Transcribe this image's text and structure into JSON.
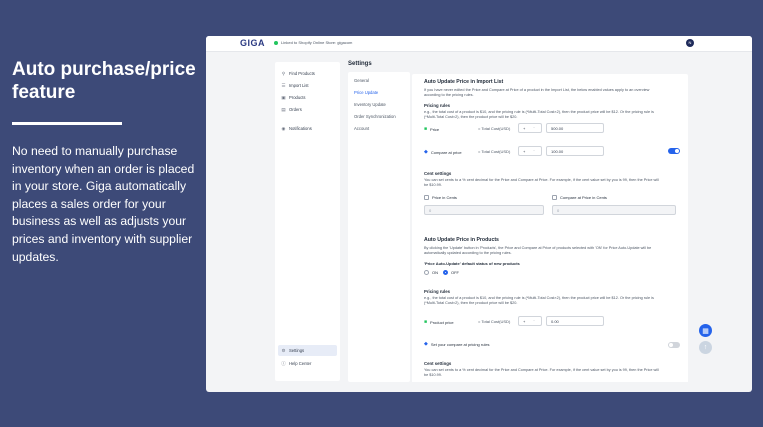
{
  "promo": {
    "title": "Auto purchase/price feature",
    "body": "No need to manually purchase inventory when an order is placed in your store. Giga automatically places a sales order for your business as well as adjusts your prices and inventory with supplier updates."
  },
  "app": {
    "logo": "GIGA",
    "connection_text": "Linked to Shopify Online Store: gigacom",
    "avatar_initial": "N",
    "page_title": "Settings"
  },
  "sidebar": {
    "items": [
      {
        "label": "Find Products",
        "icon": "search-icon"
      },
      {
        "label": "Import List",
        "icon": "list-icon"
      },
      {
        "label": "Products",
        "icon": "box-icon"
      },
      {
        "label": "Orders",
        "icon": "document-icon"
      },
      {
        "label": "Notifications",
        "icon": "bell-icon"
      },
      {
        "label": "Settings",
        "icon": "gear-icon"
      },
      {
        "label": "Help Center",
        "icon": "help-icon"
      }
    ]
  },
  "subnav": {
    "items": [
      "General",
      "Price Update",
      "Inventory Update",
      "Order Synchronization",
      "Account"
    ]
  },
  "import_card": {
    "title": "Auto Update Price in Import List",
    "desc_1": "If you have never edited the Price and Compare at Price of a product in the Import List, the below enabled values apply to an overview",
    "desc_2": "according to the pricing rules.",
    "pricing_rules": "Pricing rules",
    "rules_example_1": "e.g., the total cost of a product is $10, and the pricing rule is (*Multi-Total Cost×2), then the product price will be $12. Or the pricing rule is",
    "rules_example_2": "(*Multi-Total Cost×2), then the product price will be $20.",
    "price_label": "Price",
    "compare_label": "Compare at price",
    "total_cost_text": "= Total Cost(USD)",
    "operator": "+",
    "price_value": "500.00",
    "compare_value": "100.00",
    "cent_settings": "Cent settings",
    "cent_desc_1": "You can set cents to a % cent decimal for the Price and Compare at Price. For example, if the cent value set by you is 99, then the Price will",
    "cent_desc_2": "be $10.99.",
    "price_cents_label": "Price in Cents",
    "compare_cents_label": "Compare at Price in Cents",
    "price_cents_value": "0",
    "compare_cents_value": "0"
  },
  "products_card": {
    "title": "Auto Update Price in Products",
    "desc_1": "By clicking the 'Update' button in 'Products', the Price and Compare at Price of products selected with 'ON' for Price Auto-Update will be",
    "desc_2": "automatically updated according to the pricing rules.",
    "default_status_label": "'Price Auto-Update' default status of new products",
    "radio_off": "ON",
    "radio_on": "OFF",
    "pricing_rules": "Pricing rules",
    "rules_example_1": "e.g., the total cost of a product is $10, and the pricing rule is (*Multi-Total Cost×2), then the product price will be $12. Or the pricing rule is",
    "rules_example_2": "(*Multi-Total Cost×2), then the product price will be $20.",
    "product_price_label": "Product price",
    "total_cost_text": "= Total Cost(USD)",
    "operator": "+",
    "product_price_value": "0.00",
    "compare_toggle_label": "Set your compare at pricing rules",
    "cent_settings": "Cent settings",
    "cent_desc_1": "You can set cents to a % cent decimal for the Price and Compare at Price. For example, if the cent value set by you is 99, then the Price will",
    "cent_desc_2": "be $10.99."
  },
  "colors": {
    "background": "#3d4a78",
    "accent": "#2563eb",
    "green": "#22c55e",
    "toggle_off": "#d1d5db"
  }
}
